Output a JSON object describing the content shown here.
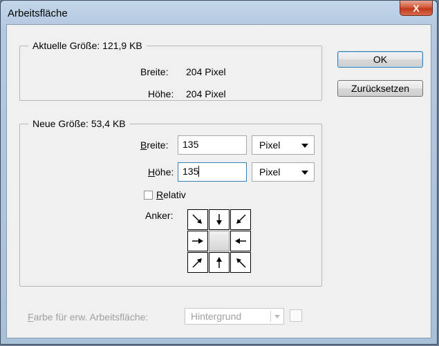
{
  "window": {
    "title": "Arbeitsfläche",
    "close_label": "X"
  },
  "current": {
    "legend": "Aktuelle Größe: 121,9 KB",
    "width_label": "Breite:",
    "width_value": "204 Pixel",
    "height_label": "Höhe:",
    "height_value": "204 Pixel"
  },
  "new_size": {
    "legend": "Neue Größe: 53,4 KB",
    "width_label_u": "B",
    "width_label_rest": "reite:",
    "width_value": "135",
    "width_unit": "Pixel",
    "height_label_u": "H",
    "height_label_rest": "öhe:",
    "height_value": "135",
    "height_unit": "Pixel",
    "relative_u": "R",
    "relative_rest": "elativ",
    "relative_checked": false,
    "anchor_label": "Anker:"
  },
  "buttons": {
    "ok": "OK",
    "reset": "Zurücksetzen"
  },
  "extension_color": {
    "label_u": "F",
    "label_rest": "arbe für erw. Arbeitsfläche:",
    "value": "Hintergrund"
  },
  "colors": {
    "focus_border": "#3c7fb1",
    "close_button": "#c0391b",
    "dialog_bg": "#f0f0f0"
  }
}
